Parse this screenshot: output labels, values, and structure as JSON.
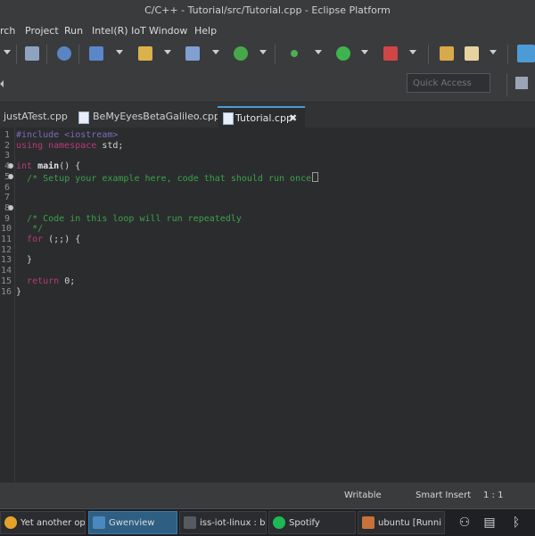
{
  "window": {
    "title": "C/C++ - Tutorial/src/Tutorial.cpp - Eclipse Platform"
  },
  "menu": {
    "items": [
      "rch",
      "Project",
      "Run",
      "Intel(R) IoT",
      "Window",
      "Help"
    ]
  },
  "toolbar": {
    "quick_access_placeholder": "Quick Access"
  },
  "tabs": [
    {
      "label": "justATest.cpp"
    },
    {
      "label": "BeMyEyesBetaGalileo.cpp"
    },
    {
      "label": "Tutorial.cpp",
      "close": "✖"
    }
  ],
  "editor": {
    "lines": [
      {
        "n": "1",
        "tokens": [
          [
            "pp",
            "#include <iostream>"
          ]
        ]
      },
      {
        "n": "2",
        "tokens": [
          [
            "kw",
            "using namespace"
          ],
          [
            "pl",
            " std;"
          ]
        ]
      },
      {
        "n": "3",
        "tokens": []
      },
      {
        "n": "4",
        "tokens": [
          [
            "kw",
            "int"
          ],
          [
            "pl",
            " "
          ],
          [
            "fn",
            "main"
          ],
          [
            "pl",
            "() {"
          ]
        ]
      },
      {
        "n": "5",
        "tokens": [
          [
            "pl",
            "  "
          ],
          [
            "cm",
            "/* Setup your example here, code that should run once"
          ]
        ]
      },
      {
        "n": "6",
        "tokens": []
      },
      {
        "n": "7",
        "tokens": []
      },
      {
        "n": "8",
        "tokens": []
      },
      {
        "n": "9",
        "tokens": [
          [
            "pl",
            "  "
          ],
          [
            "cm",
            "/* Code in this loop will run repeatedly"
          ]
        ]
      },
      {
        "n": "10",
        "tokens": [
          [
            "pl",
            "   "
          ],
          [
            "cm",
            "*/"
          ]
        ]
      },
      {
        "n": "11",
        "tokens": [
          [
            "pl",
            "  "
          ],
          [
            "kw",
            "for"
          ],
          [
            "pl",
            " (;;) {"
          ]
        ]
      },
      {
        "n": "12",
        "tokens": []
      },
      {
        "n": "13",
        "tokens": [
          [
            "pl",
            "  }"
          ]
        ]
      },
      {
        "n": "14",
        "tokens": []
      },
      {
        "n": "15",
        "tokens": [
          [
            "pl",
            "  "
          ],
          [
            "kw",
            "return"
          ],
          [
            "pl",
            " 0;"
          ]
        ]
      },
      {
        "n": "16",
        "tokens": [
          [
            "pl",
            "}"
          ]
        ]
      }
    ]
  },
  "status": {
    "writable": "Writable",
    "insert_mode": "Smart Insert",
    "position": "1 : 1"
  },
  "taskbar": {
    "tasks": [
      {
        "label": "Yet another op",
        "color": "#e2a22c"
      },
      {
        "label": "Gwenview",
        "color": "#4a89c0"
      },
      {
        "label": "iss-iot-linux : b",
        "color": "#555a60"
      },
      {
        "label": "Spotify",
        "color": "#1db954"
      },
      {
        "label": "ubuntu [Runni",
        "color": "#c6723a"
      }
    ]
  },
  "colors": {
    "keyword": "#b83a7a",
    "preprocessor": "#7b6bbb",
    "comment": "#3aa34a",
    "accent": "#4c9bd6"
  }
}
